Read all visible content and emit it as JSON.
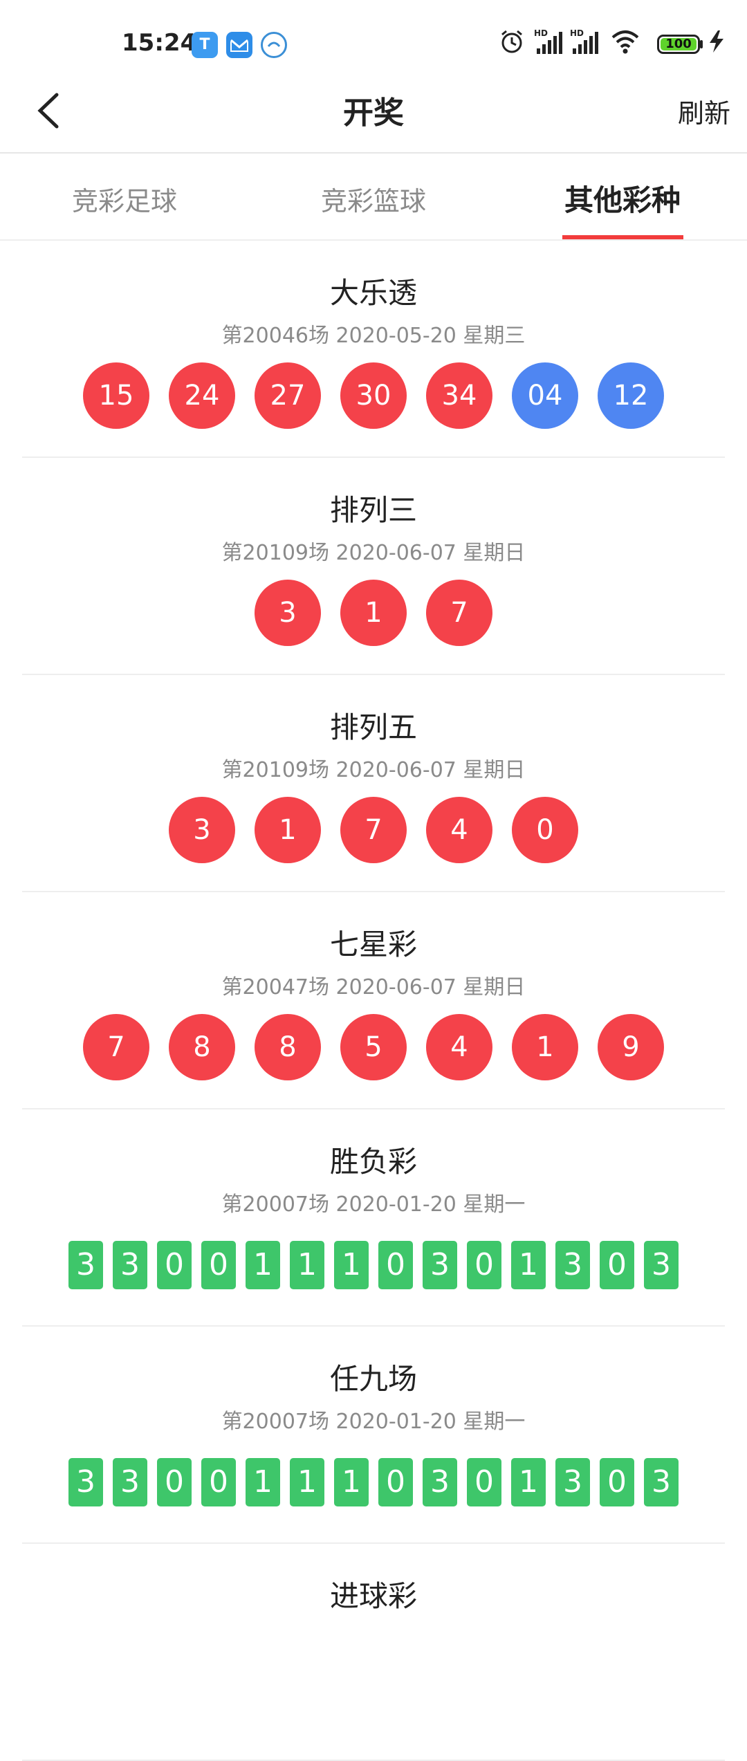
{
  "status_bar": {
    "time": "15:24",
    "battery": "100",
    "icons": [
      "t-app-icon",
      "mail-app-icon",
      "chat-app-icon",
      "alarm-icon",
      "hd-signal-icon",
      "hd-signal-icon",
      "wifi-icon",
      "battery-icon",
      "charging-icon"
    ]
  },
  "nav": {
    "title": "开奖",
    "refresh": "刷新"
  },
  "tabs": [
    {
      "label": "竞彩足球"
    },
    {
      "label": "竞彩篮球"
    },
    {
      "label": "其他彩种",
      "active": true
    }
  ],
  "lotteries": [
    {
      "name": "大乐透",
      "info": "第20046场 2020-05-20 星期三",
      "red": [
        "15",
        "24",
        "27",
        "30",
        "34"
      ],
      "blue": [
        "04",
        "12"
      ]
    },
    {
      "name": "排列三",
      "info": "第20109场 2020-06-07 星期日",
      "red": [
        "3",
        "1",
        "7"
      ]
    },
    {
      "name": "排列五",
      "info": "第20109场 2020-06-07 星期日",
      "red": [
        "3",
        "1",
        "7",
        "4",
        "0"
      ]
    },
    {
      "name": "七星彩",
      "info": "第20047场 2020-06-07 星期日",
      "red": [
        "7",
        "8",
        "8",
        "5",
        "4",
        "1",
        "9"
      ]
    },
    {
      "name": "胜负彩",
      "info": "第20007场 2020-01-20 星期一",
      "green": [
        "3",
        "3",
        "0",
        "0",
        "1",
        "1",
        "1",
        "0",
        "3",
        "0",
        "1",
        "3",
        "0",
        "3"
      ]
    },
    {
      "name": "任九场",
      "info": "第20007场 2020-01-20 星期一",
      "green": [
        "3",
        "3",
        "0",
        "0",
        "1",
        "1",
        "1",
        "0",
        "3",
        "0",
        "1",
        "3",
        "0",
        "3"
      ]
    },
    {
      "name": "进球彩"
    }
  ],
  "colors": {
    "red_ball": "#f4424a",
    "blue_ball": "#4f86f2",
    "green_block": "#3ec66a",
    "tab_accent": "#f23c3c"
  }
}
